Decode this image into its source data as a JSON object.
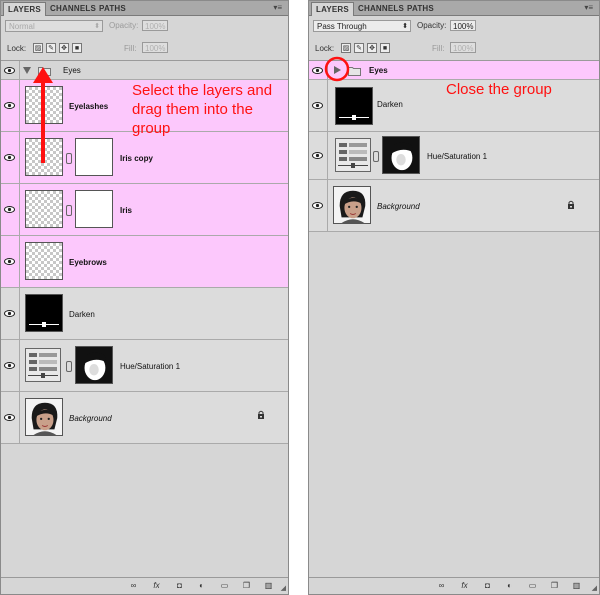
{
  "left": {
    "tabs": [
      {
        "label": "LAYERS"
      },
      {
        "label": "CHANNELS"
      },
      {
        "label": "PATHS"
      }
    ],
    "blend_mode": "Normal",
    "opacity_label": "Opacity:",
    "opacity_value": "100%",
    "lock_label": "Lock:",
    "fill_label": "Fill:",
    "fill_value": "100%",
    "group_name": "Eyes",
    "layers": [
      {
        "name": "Eyelashes"
      },
      {
        "name": "Iris copy"
      },
      {
        "name": "Iris"
      },
      {
        "name": "Eyebrows"
      },
      {
        "name": "Darken"
      },
      {
        "name": "Hue/Saturation 1"
      },
      {
        "name": "Background"
      }
    ],
    "annotation": "Select the layers and drag them into the group"
  },
  "right": {
    "tabs": [
      {
        "label": "LAYERS"
      },
      {
        "label": "CHANNELS"
      },
      {
        "label": "PATHS"
      }
    ],
    "blend_mode": "Pass Through",
    "opacity_label": "Opacity:",
    "opacity_value": "100%",
    "lock_label": "Lock:",
    "fill_label": "Fill:",
    "fill_value": "100%",
    "group_name": "Eyes",
    "layers": [
      {
        "name": "Darken"
      },
      {
        "name": "Hue/Saturation 1"
      },
      {
        "name": "Background"
      }
    ],
    "annotation": "Close the group"
  },
  "icons": [
    "eye-icon",
    "folder-icon",
    "link-icon",
    "fx-icon",
    "mask-icon",
    "adjustment-icon",
    "new-group-icon",
    "new-layer-icon",
    "trash-icon",
    "lock-icon",
    "panel-menu-icon"
  ],
  "colors": {
    "selection": "#fcc8fc",
    "annotation": "#ff1111",
    "panel": "#d6d6d6"
  }
}
